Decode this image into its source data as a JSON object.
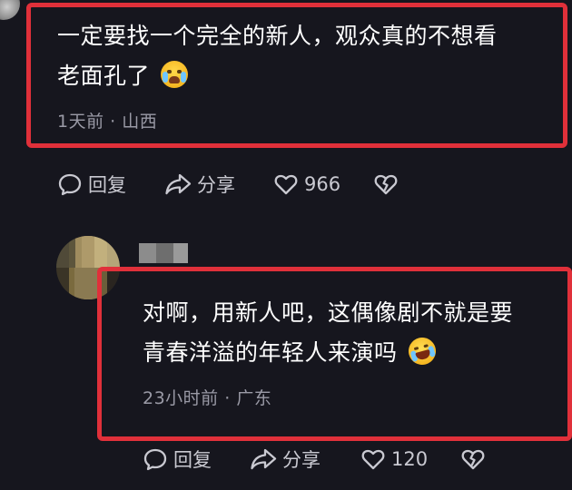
{
  "comment": {
    "text_line1": "一定要找一个完全的新人，观众真的不想看",
    "text_line2": "老面孔了",
    "emoji": "crying-face",
    "time": "1天前",
    "separator": "·",
    "location": "山西",
    "actions": {
      "reply_label": "回复",
      "share_label": "分享",
      "like_count": "966"
    }
  },
  "reply": {
    "text_line1": "对啊，用新人吧，这偶像剧不就是要",
    "text_line2": "青春洋溢的年轻人来演吗",
    "emoji": "rolling-on-floor-laughing",
    "time": "23小时前",
    "separator": "·",
    "location": "广东",
    "actions": {
      "reply_label": "回复",
      "share_label": "分享",
      "like_count": "120"
    }
  },
  "icons": {
    "reply": "speech-bubble-icon",
    "share": "share-arrow-icon",
    "like": "heart-outline-icon",
    "dislike": "broken-heart-icon"
  },
  "colors": {
    "background": "#16161e",
    "highlight_border": "#e0303a",
    "meta_text": "#9a9aa6",
    "action_text": "#c9c9d1"
  }
}
